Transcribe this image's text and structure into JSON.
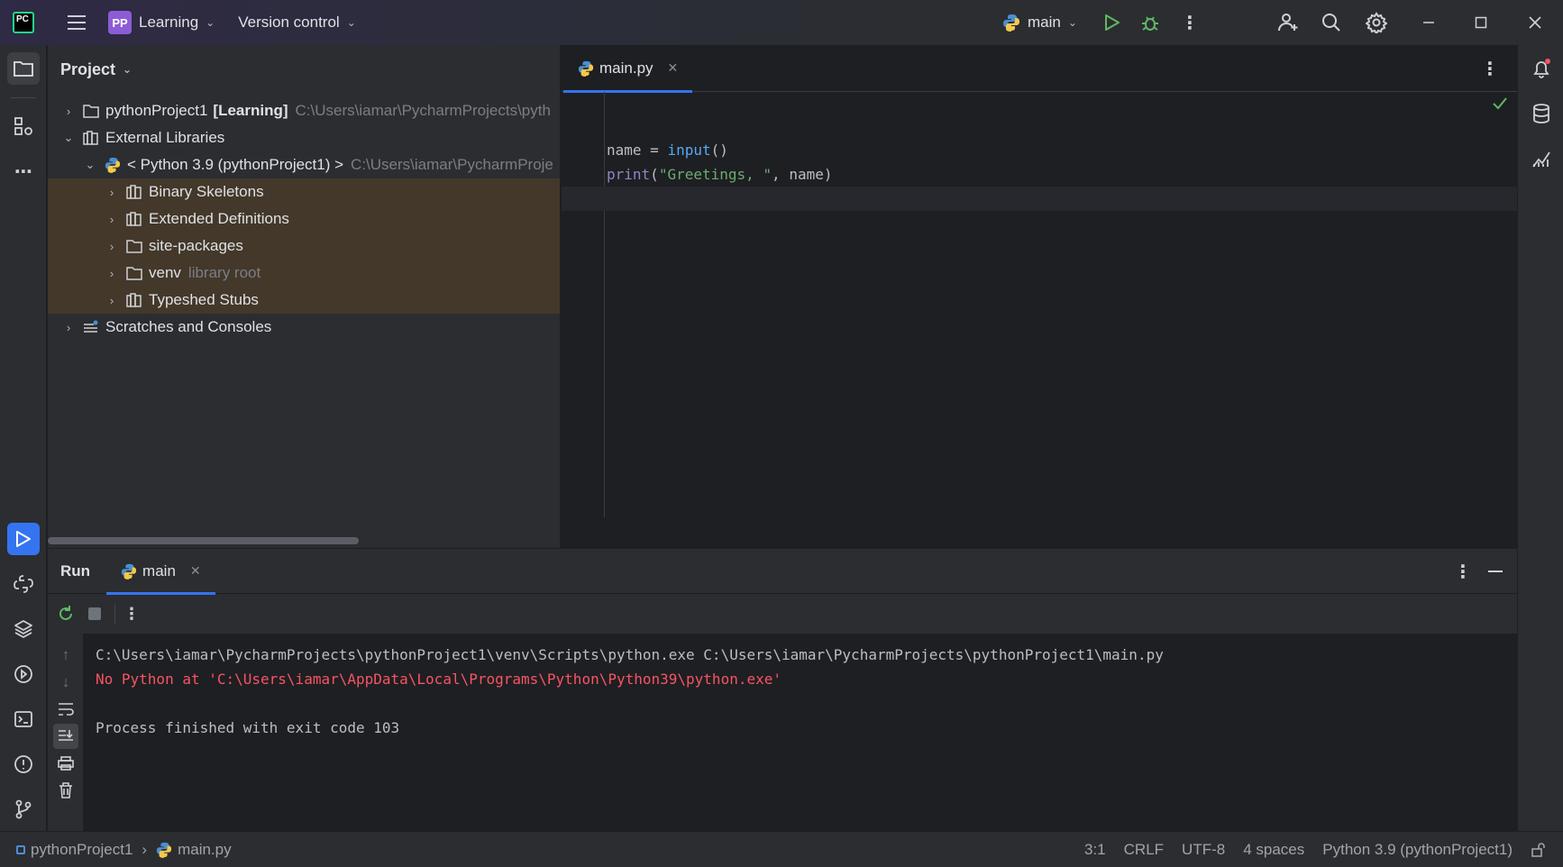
{
  "titlebar": {
    "logo_text": "PC",
    "project_badge": "PP",
    "project_name": "Learning",
    "vcs_label": "Version control",
    "run_config": "main"
  },
  "project_panel": {
    "title": "Project",
    "tree": [
      {
        "label": "pythonProject1",
        "bold_suffix": "[Learning]",
        "hint": "C:\\Users\\iamar\\PycharmProjects\\pyth",
        "expanded": false
      },
      {
        "label": "External Libraries",
        "expanded": true
      },
      {
        "label": "< Python 3.9 (pythonProject1) >",
        "hint": "C:\\Users\\iamar\\PycharmProje",
        "expanded": true
      },
      {
        "label": "Binary Skeletons",
        "expanded": false
      },
      {
        "label": "Extended Definitions",
        "expanded": false
      },
      {
        "label": "site-packages",
        "expanded": false
      },
      {
        "label": "venv",
        "hint": "library root",
        "expanded": false
      },
      {
        "label": "Typeshed Stubs",
        "expanded": false
      },
      {
        "label": "Scratches and Consoles",
        "expanded": false
      }
    ]
  },
  "editor": {
    "tab_label": "main.py",
    "code": {
      "line1": {
        "a": "name = ",
        "b": "input",
        "c": "()"
      },
      "line2": {
        "a": "print",
        "b": "(",
        "c": "\"Greetings, \"",
        "d": ", name)"
      }
    }
  },
  "run_panel": {
    "title": "Run",
    "tab_label": "main",
    "console": [
      "C:\\Users\\iamar\\PycharmProjects\\pythonProject1\\venv\\Scripts\\python.exe C:\\Users\\iamar\\PycharmProjects\\pythonProject1\\main.py",
      "No Python at 'C:\\Users\\iamar\\AppData\\Local\\Programs\\Python\\Python39\\python.exe'",
      "",
      "Process finished with exit code 103"
    ]
  },
  "statusbar": {
    "breadcrumb_project": "pythonProject1",
    "breadcrumb_file": "main.py",
    "position": "3:1",
    "line_sep": "CRLF",
    "encoding": "UTF-8",
    "indent": "4 spaces",
    "interpreter": "Python 3.9 (pythonProject1)"
  },
  "colors": {
    "accent": "#3574f0",
    "error": "#f75464",
    "highlight_row": "#43382a",
    "success": "#5fb865"
  }
}
